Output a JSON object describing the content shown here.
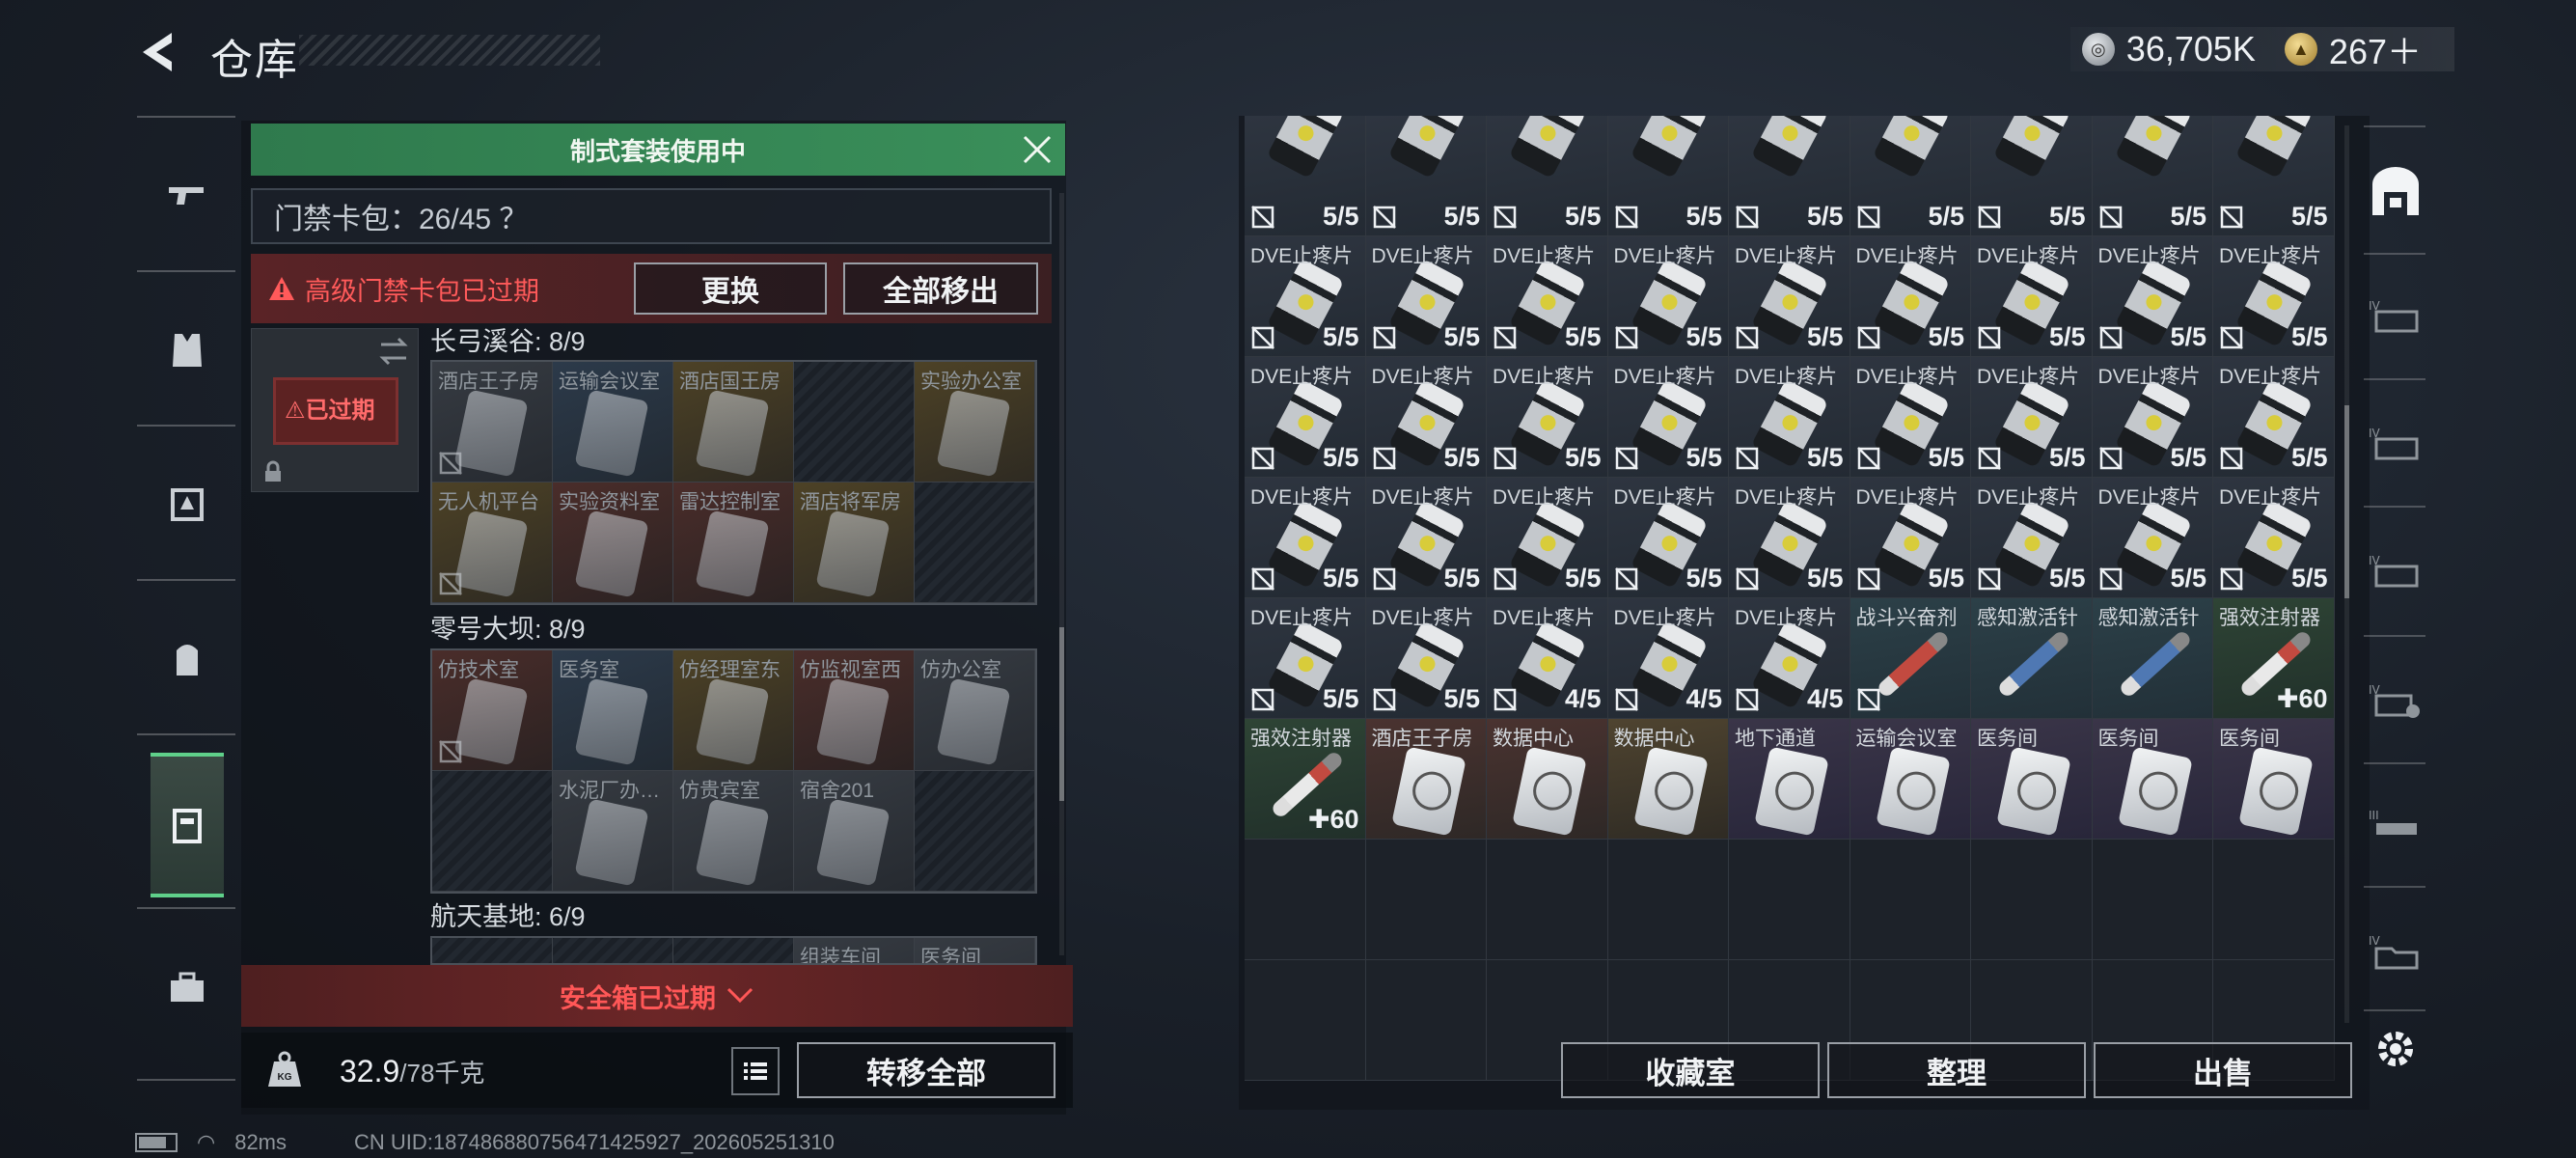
{
  "header": {
    "title": "仓库"
  },
  "currency": {
    "silver_value": "36,705K",
    "gold_value": "267＋"
  },
  "left_panel": {
    "banner": "制式套装使用中",
    "card_pack": "门禁卡包：26/45 ？",
    "alert": "高级门禁卡包已过期",
    "replace_label": "更换",
    "remove_all_label": "全部移出",
    "slot_status": "已过期",
    "sections": [
      {
        "title": "长弓溪谷: 8/9",
        "cells": [
          {
            "name": "酒店王子房",
            "tone": "gray"
          },
          {
            "name": "运输会议室",
            "tone": "blue"
          },
          {
            "name": "酒店国王房",
            "tone": "gold"
          },
          {
            "name": "",
            "tone": "empty"
          },
          {
            "name": "实验办公室",
            "tone": "gold"
          },
          {
            "name": "无人机平台",
            "tone": "gold"
          },
          {
            "name": "实验资料室",
            "tone": "red"
          },
          {
            "name": "雷达控制室",
            "tone": "red"
          },
          {
            "name": "酒店将军房",
            "tone": "gold"
          },
          {
            "name": "",
            "tone": "empty"
          }
        ]
      },
      {
        "title": "零号大坝: 8/9",
        "cells": [
          {
            "name": "仿技术室",
            "tone": "red"
          },
          {
            "name": "医务室",
            "tone": "blue"
          },
          {
            "name": "仿经理室东",
            "tone": "gold"
          },
          {
            "name": "仿监视室西",
            "tone": "red"
          },
          {
            "name": "仿办公室",
            "tone": "gray"
          },
          {
            "name": "",
            "tone": "empty"
          },
          {
            "name": "水泥厂办…",
            "tone": "gray"
          },
          {
            "name": "仿贵宾室",
            "tone": "gray"
          },
          {
            "name": "宿舍201",
            "tone": "gray"
          },
          {
            "name": "",
            "tone": "empty"
          }
        ]
      },
      {
        "title": "航天基地: 6/9",
        "cells": [
          {
            "name": "",
            "tone": "empty"
          },
          {
            "name": "",
            "tone": "empty"
          },
          {
            "name": "",
            "tone": "empty"
          },
          {
            "name": "组装车间",
            "tone": "gray"
          },
          {
            "name": "医务间",
            "tone": "gray"
          }
        ]
      }
    ],
    "safe_box": "安全箱已过期",
    "weight_value": "32.9",
    "weight_max": "/78千克",
    "transfer_all": "转移全部"
  },
  "right_panel": {
    "rows": [
      [
        {
          "kind": "pain",
          "name": "",
          "count": "5/5"
        },
        {
          "kind": "pain",
          "name": "",
          "count": "5/5"
        },
        {
          "kind": "pain",
          "name": "",
          "count": "5/5"
        },
        {
          "kind": "pain",
          "name": "",
          "count": "5/5"
        },
        {
          "kind": "pain",
          "name": "",
          "count": "5/5"
        },
        {
          "kind": "pain",
          "name": "",
          "count": "5/5"
        },
        {
          "kind": "pain",
          "name": "",
          "count": "5/5"
        },
        {
          "kind": "pain",
          "name": "",
          "count": "5/5"
        },
        {
          "kind": "pain",
          "name": "",
          "count": "5/5"
        }
      ],
      [
        {
          "kind": "pain",
          "name": "DVE止疼片",
          "count": "5/5"
        },
        {
          "kind": "pain",
          "name": "DVE止疼片",
          "count": "5/5"
        },
        {
          "kind": "pain",
          "name": "DVE止疼片",
          "count": "5/5"
        },
        {
          "kind": "pain",
          "name": "DVE止疼片",
          "count": "5/5"
        },
        {
          "kind": "pain",
          "name": "DVE止疼片",
          "count": "5/5"
        },
        {
          "kind": "pain",
          "name": "DVE止疼片",
          "count": "5/5"
        },
        {
          "kind": "pain",
          "name": "DVE止疼片",
          "count": "5/5"
        },
        {
          "kind": "pain",
          "name": "DVE止疼片",
          "count": "5/5"
        },
        {
          "kind": "pain",
          "name": "DVE止疼片",
          "count": "5/5"
        }
      ],
      [
        {
          "kind": "pain",
          "name": "DVE止疼片",
          "count": "5/5"
        },
        {
          "kind": "pain",
          "name": "DVE止疼片",
          "count": "5/5"
        },
        {
          "kind": "pain",
          "name": "DVE止疼片",
          "count": "5/5"
        },
        {
          "kind": "pain",
          "name": "DVE止疼片",
          "count": "5/5"
        },
        {
          "kind": "pain",
          "name": "DVE止疼片",
          "count": "5/5"
        },
        {
          "kind": "pain",
          "name": "DVE止疼片",
          "count": "5/5"
        },
        {
          "kind": "pain",
          "name": "DVE止疼片",
          "count": "5/5"
        },
        {
          "kind": "pain",
          "name": "DVE止疼片",
          "count": "5/5"
        },
        {
          "kind": "pain",
          "name": "DVE止疼片",
          "count": "5/5"
        }
      ],
      [
        {
          "kind": "pain",
          "name": "DVE止疼片",
          "count": "5/5"
        },
        {
          "kind": "pain",
          "name": "DVE止疼片",
          "count": "5/5"
        },
        {
          "kind": "pain",
          "name": "DVE止疼片",
          "count": "5/5"
        },
        {
          "kind": "pain",
          "name": "DVE止疼片",
          "count": "5/5"
        },
        {
          "kind": "pain",
          "name": "DVE止疼片",
          "count": "5/5"
        },
        {
          "kind": "pain",
          "name": "DVE止疼片",
          "count": "5/5"
        },
        {
          "kind": "pain",
          "name": "DVE止疼片",
          "count": "5/5"
        },
        {
          "kind": "pain",
          "name": "DVE止疼片",
          "count": "5/5"
        },
        {
          "kind": "pain",
          "name": "DVE止疼片",
          "count": "5/5"
        }
      ],
      [
        {
          "kind": "pain",
          "name": "DVE止疼片",
          "count": "5/5"
        },
        {
          "kind": "pain",
          "name": "DVE止疼片",
          "count": "5/5"
        },
        {
          "kind": "pain",
          "name": "DVE止疼片",
          "count": "4/5"
        },
        {
          "kind": "pain",
          "name": "DVE止疼片",
          "count": "4/5"
        },
        {
          "kind": "pain",
          "name": "DVE止疼片",
          "count": "4/5"
        },
        {
          "kind": "inject-red",
          "name": "战斗兴奋剂",
          "count": ""
        },
        {
          "kind": "inject-blue",
          "name": "感知激活针",
          "count": ""
        },
        {
          "kind": "inject-blue",
          "name": "感知激活针",
          "count": ""
        },
        {
          "kind": "inject-white",
          "name": "强效注射器",
          "count": "✚60"
        }
      ],
      [
        {
          "kind": "inject-white",
          "name": "强效注射器",
          "count": "✚60"
        },
        {
          "kind": "card-red",
          "name": "酒店王子房",
          "count": ""
        },
        {
          "kind": "card-red",
          "name": "数据中心",
          "count": ""
        },
        {
          "kind": "card-gold",
          "name": "数据中心",
          "count": ""
        },
        {
          "kind": "card",
          "name": "地下通道",
          "count": ""
        },
        {
          "kind": "card",
          "name": "运输会议室",
          "count": ""
        },
        {
          "kind": "card",
          "name": "医务间",
          "count": ""
        },
        {
          "kind": "card",
          "name": "医务间",
          "count": ""
        },
        {
          "kind": "card",
          "name": "医务间",
          "count": ""
        }
      ]
    ],
    "buttons": {
      "collection": "收藏室",
      "sort": "整理",
      "sell": "出售"
    }
  },
  "footer": {
    "ping": "82ms",
    "uid": "CN UID:1874868807564714259​27_202605251310"
  },
  "colors": {
    "accent_green": "#3a8f5a",
    "alert_red": "#ff5a5a"
  }
}
